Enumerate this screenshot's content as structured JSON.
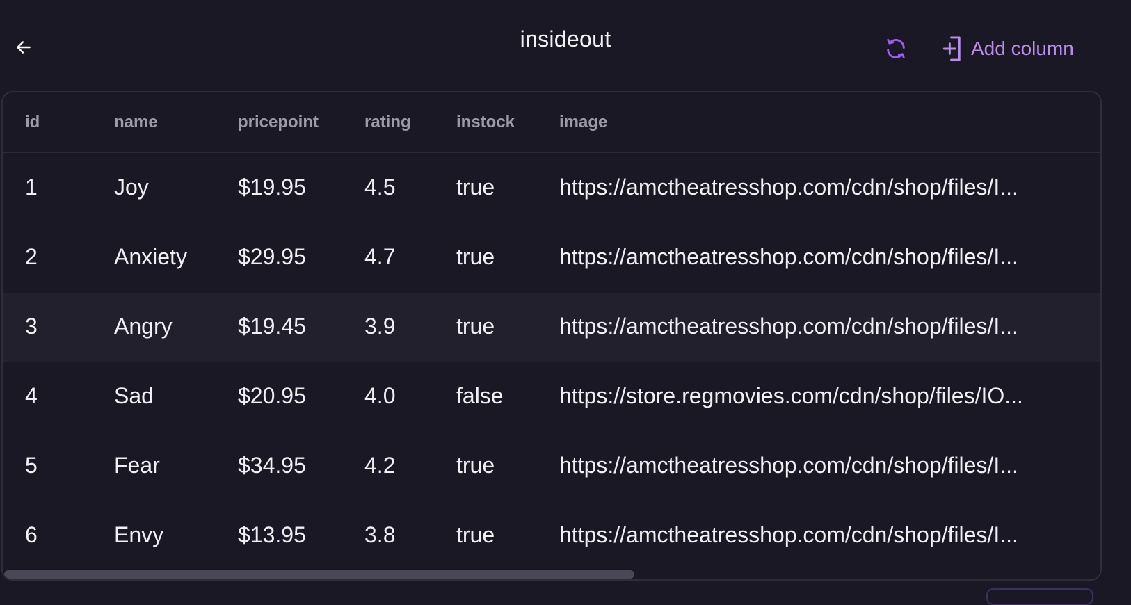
{
  "header": {
    "title": "insideout",
    "back_icon": "arrow-left-icon",
    "refresh_icon": "refresh-icon",
    "add_column_icon": "add-column-icon",
    "add_column_label": "Add column",
    "accent_color": "#b98ee8",
    "refresh_color": "#9b5cf0"
  },
  "table": {
    "columns": [
      "id",
      "name",
      "pricepoint",
      "rating",
      "instock",
      "image"
    ],
    "rows": [
      {
        "id": "1",
        "name": "Joy",
        "pricepoint": "$19.95",
        "rating": "4.5",
        "instock": "true",
        "image": "https://amctheatresshop.com/cdn/shop/files/I..."
      },
      {
        "id": "2",
        "name": "Anxiety",
        "pricepoint": "$29.95",
        "rating": "4.7",
        "instock": "true",
        "image": "https://amctheatresshop.com/cdn/shop/files/I..."
      },
      {
        "id": "3",
        "name": "Angry",
        "pricepoint": "$19.45",
        "rating": "3.9",
        "instock": "true",
        "image": "https://amctheatresshop.com/cdn/shop/files/I..."
      },
      {
        "id": "4",
        "name": "Sad",
        "pricepoint": "$20.95",
        "rating": "4.0",
        "instock": "false",
        "image": "https://store.regmovies.com/cdn/shop/files/IO..."
      },
      {
        "id": "5",
        "name": "Fear",
        "pricepoint": "$34.95",
        "rating": "4.2",
        "instock": "true",
        "image": "https://amctheatresshop.com/cdn/shop/files/I..."
      },
      {
        "id": "6",
        "name": "Envy",
        "pricepoint": "$13.95",
        "rating": "3.8",
        "instock": "true",
        "image": "https://amctheatresshop.com/cdn/shop/files/I..."
      }
    ],
    "highlighted_row": 3
  }
}
